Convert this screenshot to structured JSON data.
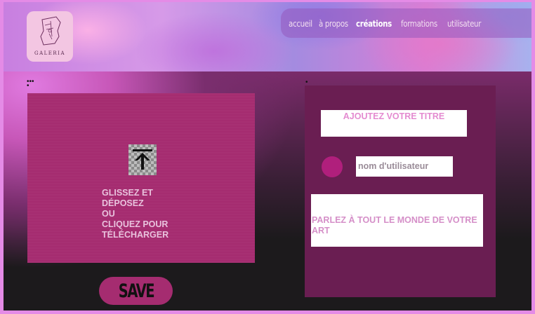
{
  "header": {
    "logo_text": "GALERIA",
    "nav": [
      {
        "label": "accueil"
      },
      {
        "label": "à propos"
      },
      {
        "label": "créations"
      },
      {
        "label": "formations"
      },
      {
        "label": "utilisateur"
      }
    ]
  },
  "upload": {
    "lines": [
      "GLISSEZ ET",
      "DÉPOSEZ",
      "OU",
      "CLIQUEZ POUR",
      "TÉLÉCHARGER"
    ],
    "icon": "upload-arrow-icon"
  },
  "save_label": "SAVE",
  "form": {
    "title_placeholder": "AJOUTEZ VOTRE TITRE",
    "username_placeholder": "nom d'utilisateur",
    "description_placeholder": "PARLEZ À TOUT LE MONDE DE VOTRE ART"
  },
  "colors": {
    "accent": "#a52c70",
    "panel": "#6a1e52",
    "avatar": "#b01f7c"
  }
}
